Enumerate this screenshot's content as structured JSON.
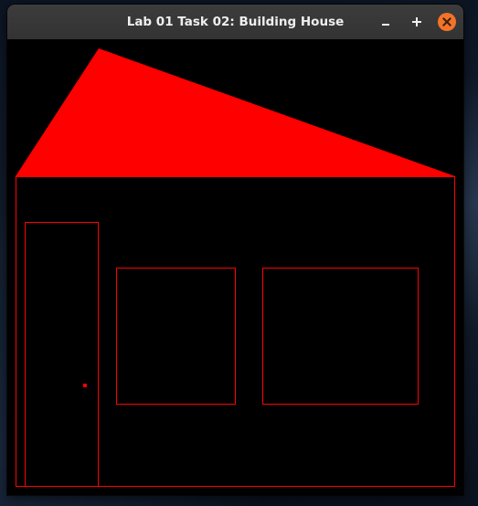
{
  "window": {
    "title": "Lab 01 Task 02: Building House"
  },
  "controls": {
    "minimize_icon": "minimize-icon",
    "maximize_icon": "maximize-icon",
    "close_icon": "close-icon",
    "close_color": "#f37329"
  },
  "scene": {
    "background_color": "#000000",
    "draw_color": "#ff0000",
    "shapes": [
      "roof",
      "house-body",
      "door",
      "door-knob",
      "left-window",
      "right-window"
    ]
  }
}
